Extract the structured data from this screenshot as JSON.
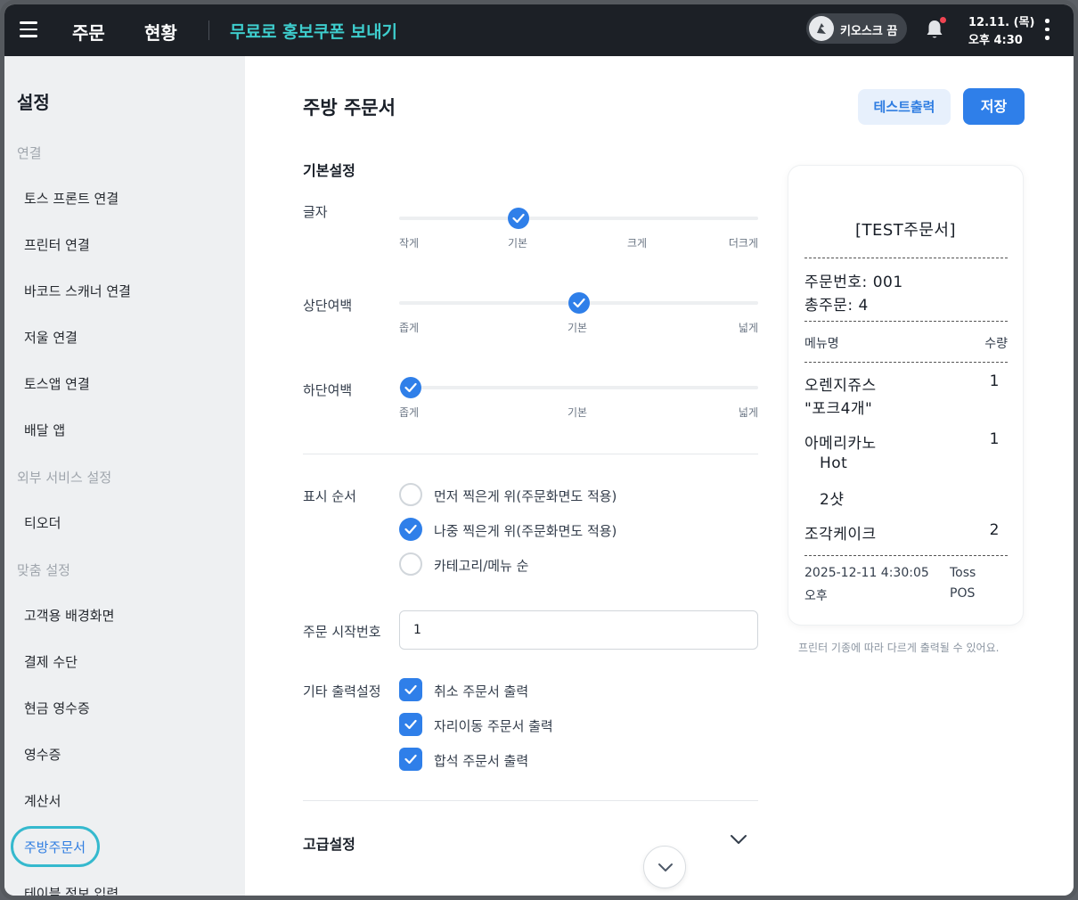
{
  "topbar": {
    "tabs": [
      "주문",
      "현황"
    ],
    "promo": "무료로 홍보쿠폰 보내기",
    "kiosk_label": "키오스크 끔",
    "date": "12.11. (목)",
    "time": "오후 4:30"
  },
  "sidebar": {
    "title": "설정",
    "sections": [
      {
        "label": "연결",
        "items": [
          "토스 프론트 연결",
          "프린터 연결",
          "바코드 스캐너 연결",
          "저울 연결",
          "토스앱 연결",
          "배달 앱"
        ]
      },
      {
        "label": "외부 서비스 설정",
        "items": [
          "티오더"
        ]
      },
      {
        "label": "맞춤 설정",
        "items": [
          "고객용 배경화면",
          "결제 수단",
          "현금 영수증",
          "영수증",
          "계산서",
          "주방주문서",
          "테이블 정보 입력"
        ]
      }
    ],
    "active_item": "주방주문서"
  },
  "main": {
    "title": "주방 주문서",
    "test_button": "테스트출력",
    "save_button": "저장",
    "basic_section": "기본설정",
    "font_size": {
      "label": "글자",
      "options": [
        "작게",
        "기본",
        "크게",
        "더크게"
      ],
      "selected": "기본"
    },
    "top_margin": {
      "label": "상단여백",
      "options": [
        "좁게",
        "기본",
        "넓게"
      ],
      "selected": "기본"
    },
    "bottom_margin": {
      "label": "하단여백",
      "options": [
        "좁게",
        "기본",
        "넓게"
      ],
      "selected": "좁게"
    },
    "display_order": {
      "label": "표시 순서",
      "options": [
        "먼저 찍은게 위(주문화면도 적용)",
        "나중 찍은게 위(주문화면도 적용)",
        "카테고리/메뉴 순"
      ],
      "selected": "나중 찍은게 위(주문화면도 적용)"
    },
    "start_number": {
      "label": "주문 시작번호",
      "value": "1"
    },
    "other_print": {
      "label": "기타 출력설정",
      "options": [
        "취소 주문서 출력",
        "자리이동 주문서 출력",
        "합석 주문서 출력"
      ],
      "checked": [
        true,
        true,
        true
      ]
    },
    "advanced_section": "고급설정"
  },
  "receipt": {
    "title": "[TEST주문서]",
    "order_number": "주문번호: 001",
    "total_orders": "총주문: 4",
    "col_menu": "메뉴명",
    "col_qty": "수량",
    "items": [
      {
        "name": "오렌지쥬스",
        "qty": "1",
        "note": "\"포크4개\""
      },
      {
        "name": "아메리카노",
        "qty": "1",
        "options": [
          "Hot",
          "2샷"
        ]
      },
      {
        "name": "조각케이크",
        "qty": "2"
      }
    ],
    "datetime": "2025-12-11 4:30:05",
    "ampm": "오후",
    "pos_line1": "Toss",
    "pos_line2": "POS",
    "note": "프린터 기종에 따라 다르게 출력될 수 있어요."
  },
  "colors": {
    "accent": "#2f7fe9",
    "promo": "#3ecdcd",
    "topbar": "#1c2026",
    "sidebar": "#eef0f2",
    "active_ring": "#35b9ce"
  }
}
